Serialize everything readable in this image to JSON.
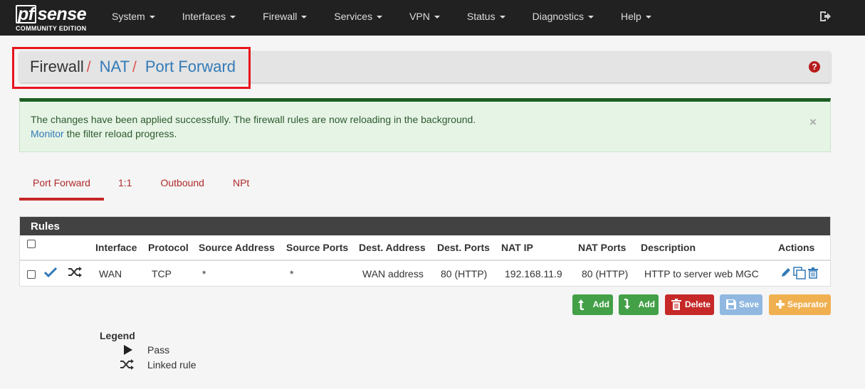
{
  "brand": {
    "logo_pf": "pf",
    "logo_text": "sense",
    "edition": "COMMUNITY EDITION"
  },
  "nav": {
    "items": [
      "System",
      "Interfaces",
      "Firewall",
      "Services",
      "VPN",
      "Status",
      "Diagnostics",
      "Help"
    ]
  },
  "breadcrumb": {
    "parts": [
      "Firewall",
      "NAT",
      "Port Forward"
    ],
    "separator": "/"
  },
  "alert": {
    "message": "The changes have been applied successfully. The firewall rules are now reloading in the background.",
    "link_text": "Monitor",
    "link_suffix": " the filter reload progress.",
    "close": "×"
  },
  "tabs": [
    "Port Forward",
    "1:1",
    "Outbound",
    "NPt"
  ],
  "rules": {
    "title": "Rules",
    "headers": [
      "Interface",
      "Protocol",
      "Source Address",
      "Source Ports",
      "Dest. Address",
      "Dest. Ports",
      "NAT IP",
      "NAT Ports",
      "Description",
      "Actions"
    ],
    "rows": [
      {
        "interface": "WAN",
        "protocol": "TCP",
        "source_address": "*",
        "source_ports": "*",
        "dest_address": "WAN address",
        "dest_ports": "80 (HTTP)",
        "nat_ip": "192.168.11.9",
        "nat_ports": "80 (HTTP)",
        "description": "HTTP to server web MGC"
      }
    ]
  },
  "buttons": {
    "add_top": "Add",
    "add_bottom": "Add",
    "delete": "Delete",
    "save": "Save",
    "separator": "Separator"
  },
  "legend": {
    "title": "Legend",
    "pass": "Pass",
    "linked": "Linked rule"
  },
  "colors": {
    "navbar": "#212121",
    "accent_red": "#c62828",
    "link_blue": "#337ab7",
    "success_border": "#1e5e23"
  }
}
